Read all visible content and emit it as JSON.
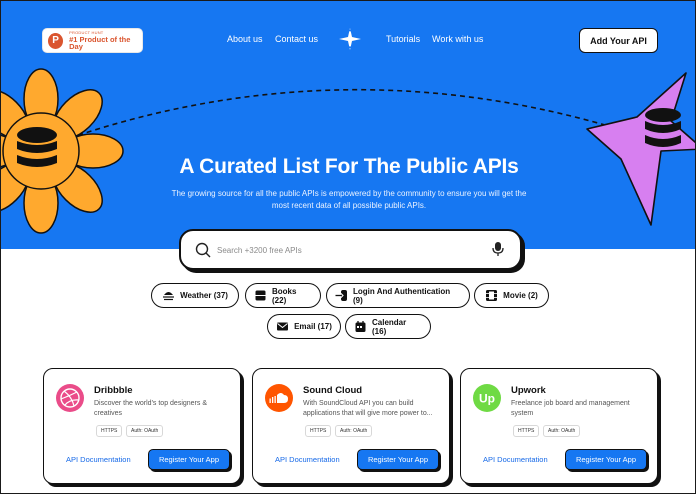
{
  "header": {
    "badge_small": "PRODUCT HUNT",
    "badge_big": "#1 Product of the Day",
    "badge_letter": "P",
    "nav": [
      {
        "label": "About us"
      },
      {
        "label": "Contact us"
      },
      {
        "label": "Tutorials"
      },
      {
        "label": "Work with us"
      }
    ],
    "cta": "Add Your API"
  },
  "hero": {
    "title": "A Curated List For The Public APIs",
    "subtitle": "The growing source for all the public APIs is empowered by the community to ensure you will get the most recent data of all possible public APIs."
  },
  "search": {
    "placeholder": "Search +3200 free APIs",
    "value": ""
  },
  "categories": [
    {
      "label": "Weather (37)",
      "icon": "weather-icon"
    },
    {
      "label": "Books (22)",
      "icon": "book-icon"
    },
    {
      "label": "Login And Authentication (9)",
      "icon": "login-icon"
    },
    {
      "label": "Movie (2)",
      "icon": "film-icon"
    },
    {
      "label": "Email (17)",
      "icon": "email-icon"
    },
    {
      "label": "Calendar (16)",
      "icon": "calendar-icon"
    }
  ],
  "cards": [
    {
      "title": "Dribbble",
      "description": "Discover the world's top designers & creatives",
      "tags": [
        "HTTPS",
        "Auth: OAuth"
      ],
      "doc_label": "API Documentation",
      "register_label": "Register Your App",
      "logo": "dribbble-logo"
    },
    {
      "title": "Sound Cloud",
      "description": "With SoundCloud API you can build applications that will give more power to...",
      "tags": [
        "HTTPS",
        "Auth: OAuth"
      ],
      "doc_label": "API Documentation",
      "register_label": "Register Your App",
      "logo": "soundcloud-logo"
    },
    {
      "title": "Upwork",
      "description": "Freelance job board and management system",
      "tags": [
        "HTTPS",
        "Auth: OAuth"
      ],
      "doc_label": "API Documentation",
      "register_label": "Register Your App",
      "logo": "upwork-logo",
      "logo_text": "Up"
    }
  ],
  "colors": {
    "hero_blue": "#1677f2",
    "flower_orange": "#ffa92e",
    "star_purple": "#d77ff0",
    "dribbble_pink": "#ea4c89",
    "soundcloud_orange": "#ff5500",
    "upwork_green": "#6fda44"
  }
}
